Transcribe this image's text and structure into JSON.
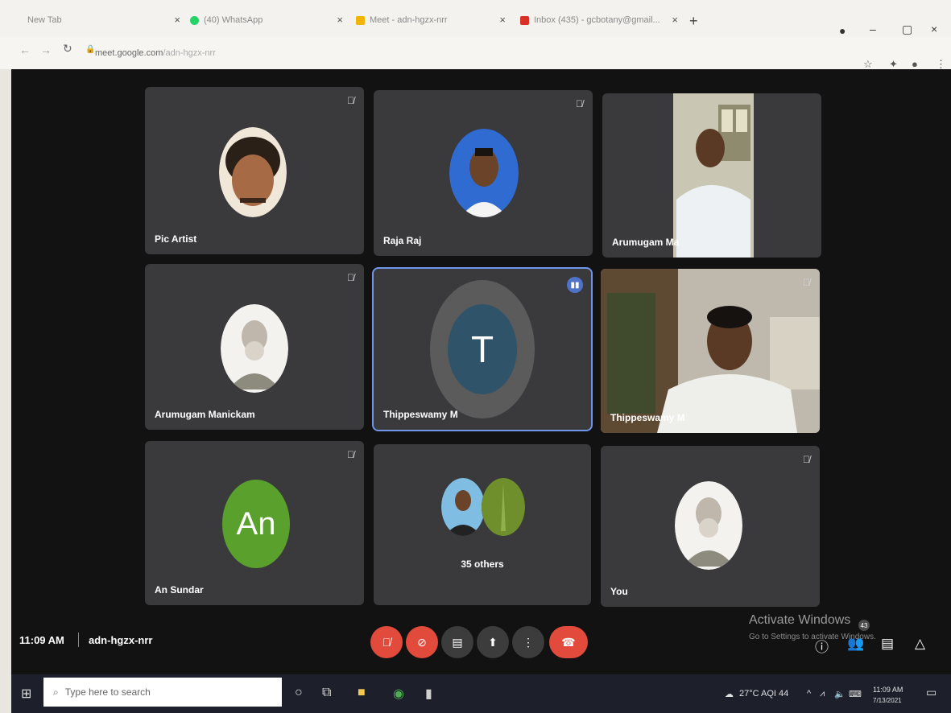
{
  "browser": {
    "tabs": [
      {
        "title": "New Tab",
        "close": "×",
        "icon_color": "#9a9a9a"
      },
      {
        "title": "(40) WhatsApp",
        "close": "×",
        "icon_color": "#25d366"
      },
      {
        "title": "Meet - adn-hgzx-nrr",
        "close": "×",
        "icon_color": "#f2b400"
      },
      {
        "title": "Inbox (435) - gcbotany@gmail...",
        "close": "×",
        "icon_color": "#d93025"
      }
    ],
    "new_tab": "+",
    "url_domain": "meet.google.com",
    "url_path": "/adn-hgzx-nrr"
  },
  "meet": {
    "tiles": [
      {
        "name": "Pic Artist",
        "kind": "photo",
        "icon": "mic-off-icon"
      },
      {
        "name": "Raja Raj",
        "kind": "photo",
        "icon": "mic-off-icon"
      },
      {
        "name": "Arumugam Ma",
        "kind": "video",
        "icon": ""
      },
      {
        "name": "Arumugam Manickam",
        "kind": "photo",
        "icon": "mic-off-icon"
      },
      {
        "name": "Thippeswamy M",
        "kind": "initial",
        "initial": "T",
        "icon": "speaking-indicator-icon"
      },
      {
        "name": "Thippeswamy M",
        "kind": "video",
        "icon": "mic-off-icon"
      },
      {
        "name": "An Sundar",
        "kind": "initial",
        "initial": "An",
        "icon": "mic-off-icon"
      },
      {
        "name": "35 others",
        "kind": "group",
        "icon": ""
      },
      {
        "name": "You",
        "kind": "photo",
        "icon": "mic-off-icon"
      }
    ],
    "time": "11:09 AM",
    "code": "adn-hgzx-nrr",
    "participants_count": "43",
    "colors": {
      "accent": "#6f96e8",
      "danger": "#e24b3c",
      "tile": "#3a3a3c",
      "initial_An": "#5aa02c"
    }
  },
  "windows": {
    "activate_title": "Activate Windows",
    "activate_sub": "Go to Settings to activate Windows.",
    "search_placeholder": "Type here to search",
    "weather": "27°C AQI 44",
    "clock_time": "11:09 AM",
    "clock_date": "7/13/2021"
  }
}
